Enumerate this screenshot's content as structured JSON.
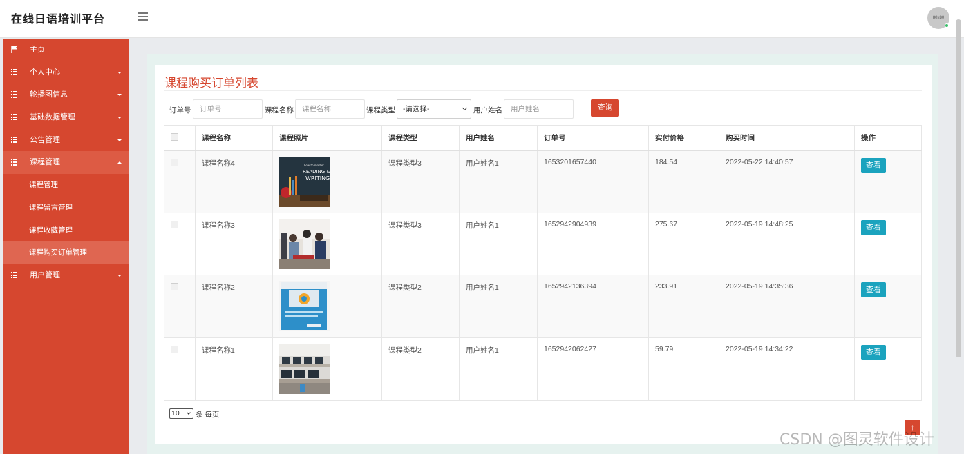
{
  "header": {
    "title": "在线日语培训平台",
    "avatar_text": "80x80"
  },
  "sidebar": {
    "items": [
      {
        "label": "主页",
        "icon": "flag-icon"
      },
      {
        "label": "个人中心",
        "icon": "grid-icon"
      },
      {
        "label": "轮播图信息",
        "icon": "grid-icon"
      },
      {
        "label": "基础数据管理",
        "icon": "grid-icon"
      },
      {
        "label": "公告管理",
        "icon": "grid-icon"
      },
      {
        "label": "课程管理",
        "icon": "grid-icon"
      },
      {
        "label": "用户管理",
        "icon": "grid-icon"
      }
    ],
    "subitems": [
      "课程管理",
      "课程留言管理",
      "课程收藏管理",
      "课程购买订单管理"
    ]
  },
  "page": {
    "title": "课程购买订单列表"
  },
  "filters": {
    "order_label": "订单号",
    "order_placeholder": "订单号",
    "course_label": "课程名称",
    "course_placeholder": "课程名称",
    "type_label": "课程类型",
    "type_value": "-请选择-",
    "user_label": "用户姓名",
    "user_placeholder": "用户姓名",
    "query_label": "查询"
  },
  "table": {
    "headers": [
      "课程名称",
      "课程照片",
      "课程类型",
      "用户姓名",
      "订单号",
      "实付价格",
      "购买时间",
      "操作"
    ],
    "view_label": "查看",
    "rows": [
      {
        "name": "课程名称4",
        "type": "课程类型3",
        "user": "用户姓名1",
        "order": "1653201657440",
        "price": "184.54",
        "time": "2022-05-22 14:40:57"
      },
      {
        "name": "课程名称3",
        "type": "课程类型3",
        "user": "用户姓名1",
        "order": "1652942904939",
        "price": "275.67",
        "time": "2022-05-19 14:48:25"
      },
      {
        "name": "课程名称2",
        "type": "课程类型2",
        "user": "用户姓名1",
        "order": "1652942136394",
        "price": "233.91",
        "time": "2022-05-19 14:35:36"
      },
      {
        "name": "课程名称1",
        "type": "课程类型2",
        "user": "用户姓名1",
        "order": "1652942062427",
        "price": "59.79",
        "time": "2022-05-19 14:34:22"
      }
    ]
  },
  "pagination": {
    "page_size": "10",
    "per_page_label": "条 每页"
  },
  "watermark": "CSDN @图灵软件设计",
  "colors": {
    "accent": "#d6472f",
    "view_button": "#1ba3be"
  }
}
